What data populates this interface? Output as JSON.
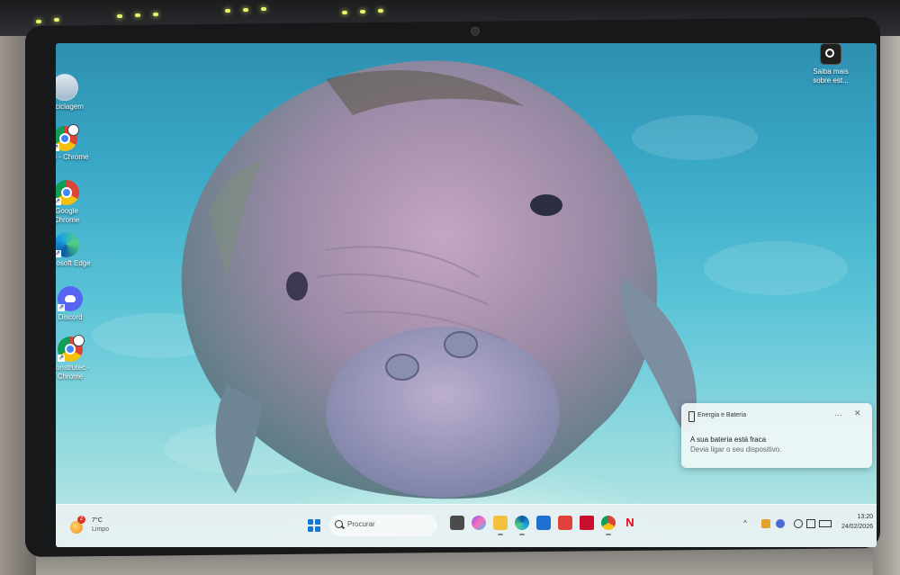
{
  "desktop": {
    "icons": [
      {
        "label": "Reciclagem",
        "icon": "recycle-bin-icon"
      },
      {
        "label": "João - Chrome",
        "icon": "chrome-profile-icon"
      },
      {
        "label": "Google Chrome",
        "icon": "chrome-icon"
      },
      {
        "label": "Microsoft Edge",
        "icon": "edge-icon"
      },
      {
        "label": "Discord",
        "icon": "discord-icon"
      },
      {
        "label": "Construtec - Chrome",
        "icon": "chrome-profile-icon"
      }
    ],
    "learn_more": {
      "label": "Saiba mais sobre est..."
    }
  },
  "notification": {
    "app": "Energia e Bateria",
    "title": "A sua bateria está fraca",
    "body": "Devia ligar o seu dispositivo."
  },
  "taskbar": {
    "weather": {
      "temp": "7°C",
      "condition": "Limpo",
      "badge": "2"
    },
    "search_placeholder": "Procurar",
    "pinned": [
      {
        "name": "file-manager-icon",
        "color": "#4b4b4b"
      },
      {
        "name": "copilot-icon",
        "color": "#7a5cff"
      },
      {
        "name": "file-explorer-icon",
        "color": "#f3c23c"
      },
      {
        "name": "edge-icon",
        "color": "#1ba1e2"
      },
      {
        "name": "store-icon",
        "color": "#1f6fd1"
      },
      {
        "name": "app-l-icon",
        "color": "#e0413a"
      },
      {
        "name": "mcafee-icon",
        "color": "#c8102e"
      },
      {
        "name": "chrome-profile-icon",
        "color": "#0f9d58"
      },
      {
        "name": "netflix-icon",
        "color": "#e50914"
      }
    ],
    "clock": {
      "time": "13:20",
      "date": "24/02/2026"
    }
  }
}
